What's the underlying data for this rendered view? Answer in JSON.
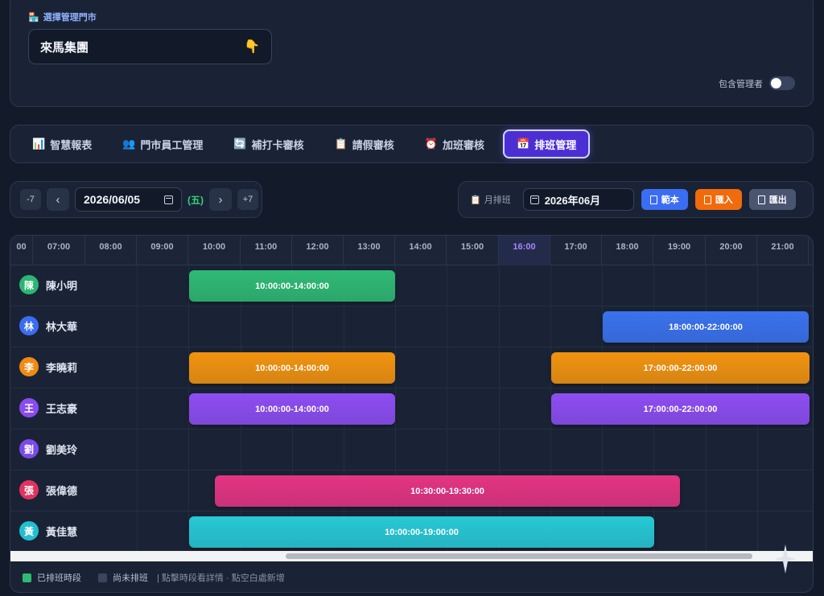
{
  "store": {
    "label": "選擇管理門市",
    "selected": "來馬集團",
    "toggle_label": "包含管理者"
  },
  "tabs": [
    {
      "icon": "📊",
      "label": "智慧報表"
    },
    {
      "icon": "👥",
      "label": "門市員工管理"
    },
    {
      "icon": "🔄",
      "label": "補打卡審核"
    },
    {
      "icon": "📋",
      "label": "請假審核"
    },
    {
      "icon": "⏰",
      "label": "加班審核"
    },
    {
      "icon": "📅",
      "label": "排班管理"
    }
  ],
  "date_nav": {
    "minus7": "-7",
    "prev": "‹",
    "date": "2026/06/05",
    "weekday": "(五)",
    "next": "›",
    "plus7": "+7"
  },
  "month_bar": {
    "label": "月排班",
    "month": "2026年06月",
    "btn_template": "範本",
    "btn_import": "匯入",
    "btn_export": "匯出"
  },
  "hours": [
    "00",
    "07:00",
    "08:00",
    "09:00",
    "10:00",
    "11:00",
    "12:00",
    "13:00",
    "14:00",
    "15:00",
    "16:00",
    "17:00",
    "18:00",
    "19:00",
    "20:00",
    "21:00"
  ],
  "employees": [
    {
      "initial": "陳",
      "name": "陳小明",
      "color": "#2bb673"
    },
    {
      "initial": "林",
      "name": "林大華",
      "color": "#3b6df2"
    },
    {
      "initial": "李",
      "name": "李曉莉",
      "color": "#f08a12"
    },
    {
      "initial": "王",
      "name": "王志豪",
      "color": "#8a4bf0"
    },
    {
      "initial": "劉",
      "name": "劉美玲",
      "color": "#7b4ae8"
    },
    {
      "initial": "張",
      "name": "張偉德",
      "color": "#e0335f"
    },
    {
      "initial": "黃",
      "name": "黃佳慧",
      "color": "#22bfd0"
    }
  ],
  "shifts": [
    {
      "row": 0,
      "label": "10:00:00-14:00:00",
      "color": "#2fba74"
    },
    {
      "row": 1,
      "label": "18:00:00-22:00:00",
      "color": "#3a72ee"
    },
    {
      "row": 2,
      "label": "10:00:00-14:00:00",
      "color": "#f2930f"
    },
    {
      "row": 2,
      "label": "17:00:00-22:00:00",
      "color": "#f2930f"
    },
    {
      "row": 3,
      "label": "10:00:00-14:00:00",
      "color": "#8d4df2"
    },
    {
      "row": 3,
      "label": "17:00:00-22:00:00",
      "color": "#8d4df2"
    },
    {
      "row": 5,
      "label": "10:30:00-19:30:00",
      "color": "#e43482"
    },
    {
      "row": 6,
      "label": "10:00:00-19:00:00",
      "color": "#27c9d6"
    }
  ],
  "legend": {
    "scheduled": "已排班時段",
    "unscheduled": "尚未排班",
    "hint": "| 點擊時段看詳情 · 點空白處新增",
    "scheduled_color": "#2fba74",
    "unscheduled_color": "#3a465e"
  },
  "current_hour": "16:00"
}
